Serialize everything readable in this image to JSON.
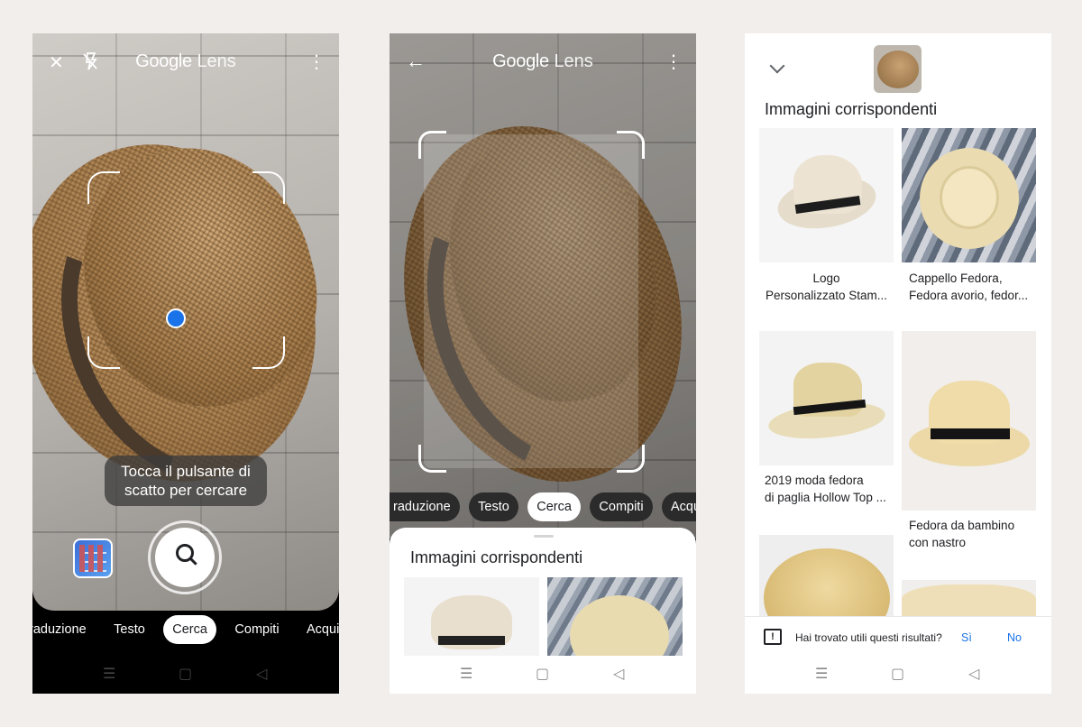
{
  "app": {
    "title_google": "Google",
    "title_lens": "Lens"
  },
  "screen1": {
    "close_icon": "✕",
    "flash_icon": "flash-off-icon",
    "menu_icon": "⋮",
    "hint_line1": "Tocca il pulsante di",
    "hint_line2": "scatto per cercare",
    "modes": [
      "raduzione",
      "Testo",
      "Cerca",
      "Compiti",
      "Acquist"
    ],
    "active_mode": "Cerca"
  },
  "screen2": {
    "back_icon": "←",
    "menu_icon": "⋮",
    "modes": [
      "raduzione",
      "Testo",
      "Cerca",
      "Compiti",
      "Acquist"
    ],
    "sheet_title": "Immagini corrispondenti"
  },
  "screen3": {
    "section_title": "Immagini corrispondenti",
    "results": [
      {
        "line1": "Logo",
        "line2": "Personalizzato Stam..."
      },
      {
        "line1": "Cappello Fedora,",
        "line2": "Fedora avorio, fedor..."
      },
      {
        "line1": "2019 moda fedora",
        "line2": "di paglia Hollow Top ..."
      },
      {
        "line1": "Fedora da bambino",
        "line2": "con nastro"
      }
    ],
    "feedback": {
      "question": "Hai trovato utili questi risultati?",
      "yes": "Sì",
      "no": "No"
    }
  },
  "navbar": {
    "menu": "☰",
    "home": "▢",
    "back": "◁"
  },
  "colors": {
    "accent_blue": "#1a73e8",
    "chip_active_bg": "#ffffff",
    "chip_bg": "#3c3c3c"
  }
}
